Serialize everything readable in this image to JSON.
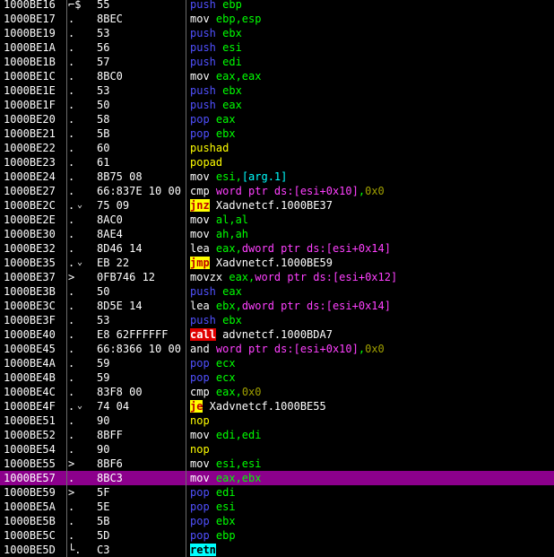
{
  "disassembly": {
    "selected_address": "1000BE57",
    "rows": [
      {
        "addr": "1000BE16",
        "m1": "⌐$",
        "m2": "",
        "bytes": "55",
        "mn": "push",
        "mc": "blue",
        "ops": [
          {
            "t": " ebp",
            "c": "green"
          }
        ]
      },
      {
        "addr": "1000BE17",
        "m1": ".",
        "m2": "",
        "bytes": "8BEC",
        "mn": "mov",
        "mc": "white",
        "ops": [
          {
            "t": " ebp,esp",
            "c": "green"
          }
        ]
      },
      {
        "addr": "1000BE19",
        "m1": ".",
        "m2": "",
        "bytes": "53",
        "mn": "push",
        "mc": "blue",
        "ops": [
          {
            "t": " ebx",
            "c": "green"
          }
        ]
      },
      {
        "addr": "1000BE1A",
        "m1": ".",
        "m2": "",
        "bytes": "56",
        "mn": "push",
        "mc": "blue",
        "ops": [
          {
            "t": " esi",
            "c": "green"
          }
        ]
      },
      {
        "addr": "1000BE1B",
        "m1": ".",
        "m2": "",
        "bytes": "57",
        "mn": "push",
        "mc": "blue",
        "ops": [
          {
            "t": " edi",
            "c": "green"
          }
        ]
      },
      {
        "addr": "1000BE1C",
        "m1": ".",
        "m2": "",
        "bytes": "8BC0",
        "mn": "mov",
        "mc": "white",
        "ops": [
          {
            "t": " eax,eax",
            "c": "green"
          }
        ]
      },
      {
        "addr": "1000BE1E",
        "m1": ".",
        "m2": "",
        "bytes": "53",
        "mn": "push",
        "mc": "blue",
        "ops": [
          {
            "t": " ebx",
            "c": "green"
          }
        ]
      },
      {
        "addr": "1000BE1F",
        "m1": ".",
        "m2": "",
        "bytes": "50",
        "mn": "push",
        "mc": "blue",
        "ops": [
          {
            "t": " eax",
            "c": "green"
          }
        ]
      },
      {
        "addr": "1000BE20",
        "m1": ".",
        "m2": "",
        "bytes": "58",
        "mn": "pop",
        "mc": "blue",
        "ops": [
          {
            "t": " eax",
            "c": "green"
          }
        ]
      },
      {
        "addr": "1000BE21",
        "m1": ".",
        "m2": "",
        "bytes": "5B",
        "mn": "pop",
        "mc": "blue",
        "ops": [
          {
            "t": " ebx",
            "c": "green"
          }
        ]
      },
      {
        "addr": "1000BE22",
        "m1": ".",
        "m2": "",
        "bytes": "60",
        "mn": "pushad",
        "mc": "yellow",
        "ops": []
      },
      {
        "addr": "1000BE23",
        "m1": ".",
        "m2": "",
        "bytes": "61",
        "mn": "popad",
        "mc": "yellow",
        "ops": []
      },
      {
        "addr": "1000BE24",
        "m1": ".",
        "m2": "",
        "bytes": "8B75 08",
        "mn": "mov",
        "mc": "white",
        "ops": [
          {
            "t": " esi,",
            "c": "green"
          },
          {
            "t": "[arg.1]",
            "c": "cyan"
          }
        ]
      },
      {
        "addr": "1000BE27",
        "m1": ".",
        "m2": "",
        "bytes": "66:837E 10 00",
        "mn": "cmp",
        "mc": "white",
        "ops": [
          {
            "t": " word ptr ds:[esi+0x10]",
            "c": "magenta"
          },
          {
            "t": ",",
            "c": "green"
          },
          {
            "t": "0x0",
            "c": "olive"
          }
        ]
      },
      {
        "addr": "1000BE2C",
        "m1": ".",
        "m2": "⌄",
        "bytes": "75 09",
        "mn": "jnz",
        "mc": "hl-yellow",
        "ops": [
          {
            "t": " Xadvnetcf.1000BE37",
            "c": "white"
          }
        ]
      },
      {
        "addr": "1000BE2E",
        "m1": ".",
        "m2": "",
        "bytes": "8AC0",
        "mn": "mov",
        "mc": "white",
        "ops": [
          {
            "t": " al,al",
            "c": "green"
          }
        ]
      },
      {
        "addr": "1000BE30",
        "m1": ".",
        "m2": "",
        "bytes": "8AE4",
        "mn": "mov",
        "mc": "white",
        "ops": [
          {
            "t": " ah,ah",
            "c": "green"
          }
        ]
      },
      {
        "addr": "1000BE32",
        "m1": ".",
        "m2": "",
        "bytes": "8D46 14",
        "mn": "lea",
        "mc": "white",
        "ops": [
          {
            "t": " eax,",
            "c": "green"
          },
          {
            "t": "dword ptr ds:[esi+0x14]",
            "c": "magenta"
          }
        ]
      },
      {
        "addr": "1000BE35",
        "m1": ".",
        "m2": "⌄",
        "bytes": "EB 22",
        "mn": "jmp",
        "mc": "hl-yellow",
        "ops": [
          {
            "t": " Xadvnetcf.1000BE59",
            "c": "white"
          }
        ]
      },
      {
        "addr": "1000BE37",
        "m1": ">",
        "m2": "",
        "bytes": "0FB746 12",
        "mn": "movzx",
        "mc": "white",
        "ops": [
          {
            "t": " eax,",
            "c": "green"
          },
          {
            "t": "word ptr ds:[esi+0x12]",
            "c": "magenta"
          }
        ]
      },
      {
        "addr": "1000BE3B",
        "m1": ".",
        "m2": "",
        "bytes": "50",
        "mn": "push",
        "mc": "blue",
        "ops": [
          {
            "t": " eax",
            "c": "green"
          }
        ]
      },
      {
        "addr": "1000BE3C",
        "m1": ".",
        "m2": "",
        "bytes": "8D5E 14",
        "mn": "lea",
        "mc": "white",
        "ops": [
          {
            "t": " ebx,",
            "c": "green"
          },
          {
            "t": "dword ptr ds:[esi+0x14]",
            "c": "magenta"
          }
        ]
      },
      {
        "addr": "1000BE3F",
        "m1": ".",
        "m2": "",
        "bytes": "53",
        "mn": "push",
        "mc": "blue",
        "ops": [
          {
            "t": " ebx",
            "c": "green"
          }
        ]
      },
      {
        "addr": "1000BE40",
        "m1": ".",
        "m2": "",
        "bytes": "E8 62FFFFFF",
        "mn": "call",
        "mc": "hl-red",
        "ops": [
          {
            "t": " advnetcf.1000BDA7",
            "c": "white"
          }
        ]
      },
      {
        "addr": "1000BE45",
        "m1": ".",
        "m2": "",
        "bytes": "66:8366 10 00",
        "mn": "and",
        "mc": "white",
        "ops": [
          {
            "t": " word ptr ds:[esi+0x10]",
            "c": "magenta"
          },
          {
            "t": ",",
            "c": "green"
          },
          {
            "t": "0x0",
            "c": "olive"
          }
        ]
      },
      {
        "addr": "1000BE4A",
        "m1": ".",
        "m2": "",
        "bytes": "59",
        "mn": "pop",
        "mc": "blue",
        "ops": [
          {
            "t": " ecx",
            "c": "green"
          }
        ]
      },
      {
        "addr": "1000BE4B",
        "m1": ".",
        "m2": "",
        "bytes": "59",
        "mn": "pop",
        "mc": "blue",
        "ops": [
          {
            "t": " ecx",
            "c": "green"
          }
        ]
      },
      {
        "addr": "1000BE4C",
        "m1": ".",
        "m2": "",
        "bytes": "83F8 00",
        "mn": "cmp",
        "mc": "white",
        "ops": [
          {
            "t": " eax,",
            "c": "green"
          },
          {
            "t": "0x0",
            "c": "olive"
          }
        ]
      },
      {
        "addr": "1000BE4F",
        "m1": ".",
        "m2": "⌄",
        "bytes": "74 04",
        "mn": "je",
        "mc": "hl-yellow",
        "ops": [
          {
            "t": " Xadvnetcf.1000BE55",
            "c": "white"
          }
        ]
      },
      {
        "addr": "1000BE51",
        "m1": ".",
        "m2": "",
        "bytes": "90",
        "mn": "nop",
        "mc": "yellow",
        "ops": []
      },
      {
        "addr": "1000BE52",
        "m1": ".",
        "m2": "",
        "bytes": "8BFF",
        "mn": "mov",
        "mc": "white",
        "ops": [
          {
            "t": " edi,edi",
            "c": "green"
          }
        ]
      },
      {
        "addr": "1000BE54",
        "m1": ".",
        "m2": "",
        "bytes": "90",
        "mn": "nop",
        "mc": "yellow",
        "ops": []
      },
      {
        "addr": "1000BE55",
        "m1": ">",
        "m2": "",
        "bytes": "8BF6",
        "mn": "mov",
        "mc": "white",
        "ops": [
          {
            "t": " esi,esi",
            "c": "green"
          }
        ]
      },
      {
        "addr": "1000BE57",
        "m1": ".",
        "m2": "",
        "bytes": "8BC3",
        "mn": "mov",
        "mc": "white",
        "ops": [
          {
            "t": " eax,ebx",
            "c": "green"
          }
        ]
      },
      {
        "addr": "1000BE59",
        "m1": ">",
        "m2": "",
        "bytes": "5F",
        "mn": "pop",
        "mc": "blue",
        "ops": [
          {
            "t": " edi",
            "c": "green"
          }
        ]
      },
      {
        "addr": "1000BE5A",
        "m1": ".",
        "m2": "",
        "bytes": "5E",
        "mn": "pop",
        "mc": "blue",
        "ops": [
          {
            "t": " esi",
            "c": "green"
          }
        ]
      },
      {
        "addr": "1000BE5B",
        "m1": ".",
        "m2": "",
        "bytes": "5B",
        "mn": "pop",
        "mc": "blue",
        "ops": [
          {
            "t": " ebx",
            "c": "green"
          }
        ]
      },
      {
        "addr": "1000BE5C",
        "m1": ".",
        "m2": "",
        "bytes": "5D",
        "mn": "pop",
        "mc": "blue",
        "ops": [
          {
            "t": " ebp",
            "c": "green"
          }
        ]
      },
      {
        "addr": "1000BE5D",
        "m1": "└.",
        "m2": "",
        "bytes": "C3",
        "mn": "retn",
        "mc": "hl-cyan",
        "ops": []
      }
    ]
  },
  "colors": {
    "background": "#000000",
    "selection": "#8c008c",
    "push_pop": "#5050ff",
    "register": "#00ff00",
    "memory_operand": "#ff40ff",
    "immediate": "#a0a000",
    "jump_highlight": "#ffff00",
    "call_highlight": "#e00000",
    "ret_highlight": "#00ffff"
  }
}
